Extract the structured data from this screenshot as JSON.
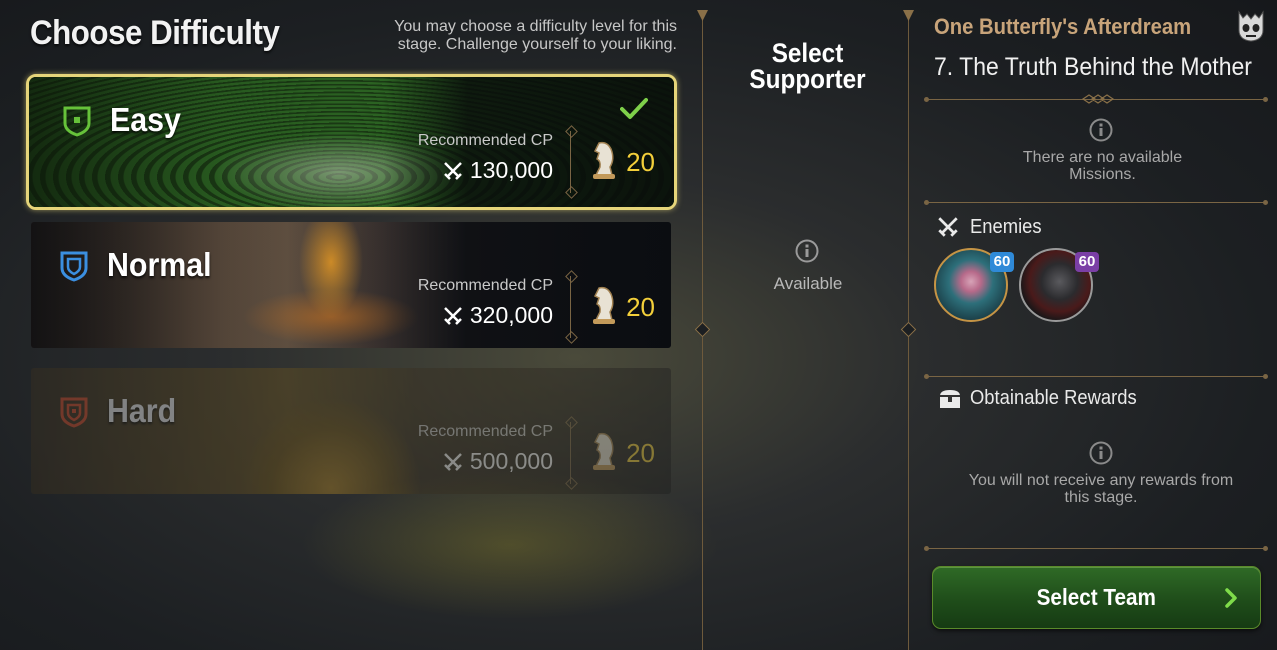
{
  "header": {
    "title": "Choose Difficulty",
    "subtitle": "You may choose a difficulty level for this stage. Challenge yourself to your liking."
  },
  "difficulties": [
    {
      "name": "Easy",
      "rec_label": "Recommended CP",
      "cp": "130,000",
      "stamina": "20",
      "selected": true,
      "icon_color": "#66c23a"
    },
    {
      "name": "Normal",
      "rec_label": "Recommended CP",
      "cp": "320,000",
      "stamina": "20",
      "selected": false,
      "icon_color": "#3b8fe0"
    },
    {
      "name": "Hard",
      "rec_label": "Recommended CP",
      "cp": "500,000",
      "stamina": "20",
      "selected": false,
      "locked": true,
      "icon_color": "#e0522d"
    }
  ],
  "supporter": {
    "title": "Select Supporter",
    "status": "Available"
  },
  "stage": {
    "story": "One Butterfly's Afterdream",
    "title": "7. The Truth Behind the Mother",
    "missions_empty": "There are no available Missions.",
    "enemies_label": "Enemies",
    "enemies": [
      {
        "name": "enemy-1",
        "level": "60",
        "badge_color": "#2f8ad8"
      },
      {
        "name": "enemy-2",
        "level": "60",
        "badge_color": "#7b3fa6"
      }
    ],
    "rewards_label": "Obtainable Rewards",
    "rewards_empty": "You will not receive any rewards from this stage.",
    "select_team_label": "Select Team"
  },
  "colors": {
    "accent_gold": "#e6d57a",
    "stamina_yellow": "#f3cf3a",
    "story_title": "#c8a47a",
    "button_green": "#2f6a26"
  }
}
